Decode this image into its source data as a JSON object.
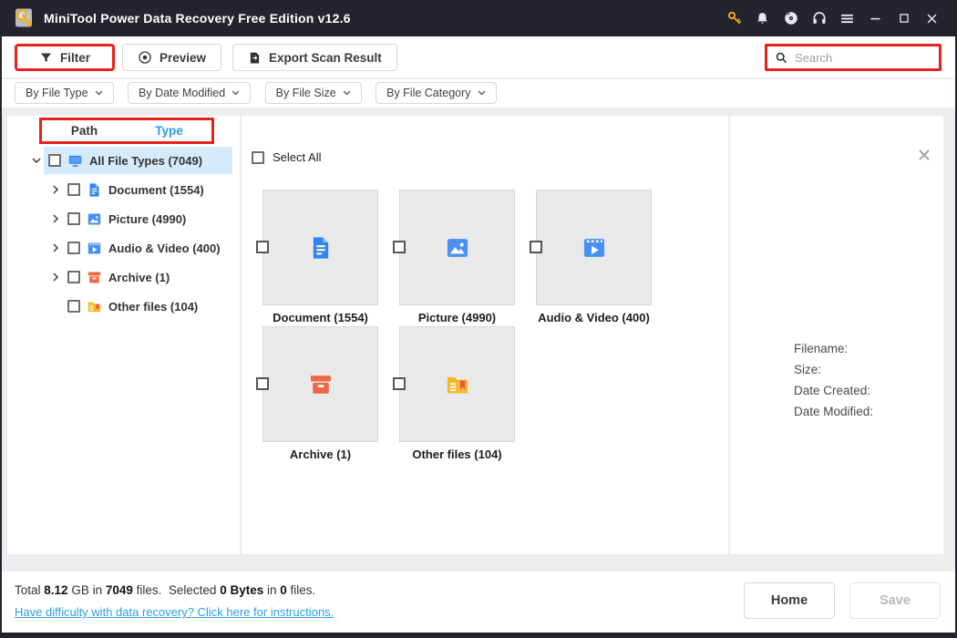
{
  "window": {
    "title": "MiniTool Power Data Recovery Free Edition v12.6"
  },
  "titlebar": {
    "icons": [
      "key",
      "bell",
      "disc",
      "headset",
      "menu",
      "minimize",
      "maximize",
      "close"
    ]
  },
  "toolbar": {
    "filter_label": "Filter",
    "preview_label": "Preview",
    "export_label": "Export Scan Result",
    "search_placeholder": "Search"
  },
  "filters": {
    "items": [
      {
        "label": "By File Type"
      },
      {
        "label": "By Date Modified"
      },
      {
        "label": "By File Size"
      },
      {
        "label": "By File Category"
      }
    ]
  },
  "sidebar": {
    "tabs": {
      "path": "Path",
      "type": "Type"
    },
    "items": [
      {
        "label": "All File Types (7049)",
        "icon": "monitor",
        "selected": true,
        "expanded": true
      },
      {
        "label": "Document (1554)",
        "icon": "document"
      },
      {
        "label": "Picture (4990)",
        "icon": "picture"
      },
      {
        "label": "Audio & Video (400)",
        "icon": "video"
      },
      {
        "label": "Archive (1)",
        "icon": "archive"
      },
      {
        "label": "Other files (104)",
        "icon": "folder"
      }
    ]
  },
  "main": {
    "select_all_label": "Select All",
    "cards": [
      {
        "label": "Document (1554)",
        "icon": "document"
      },
      {
        "label": "Picture (4990)",
        "icon": "picture"
      },
      {
        "label": "Audio & Video (400)",
        "icon": "video"
      },
      {
        "label": "Archive (1)",
        "icon": "archive"
      },
      {
        "label": "Other files (104)",
        "icon": "folder"
      }
    ]
  },
  "details": {
    "filename_label": "Filename:",
    "size_label": "Size:",
    "date_created_label": "Date Created:",
    "date_modified_label": "Date Modified:"
  },
  "footer": {
    "total_label": "Total ",
    "total_size": "8.12",
    "after_size": " GB in ",
    "total_count": "7049",
    "after_count": " files.  ",
    "selected_label": "Selected ",
    "selected_size": "0 Bytes",
    "after_sel_size": " in ",
    "selected_count": "0",
    "after_sel_count": " files.",
    "link_text": "Have difficulty with data recovery? Click here for instructions.",
    "home_label": "Home",
    "save_label": "Save"
  },
  "colors": {
    "titlebar": "#24242e",
    "annotation_red": "#e8221a",
    "accent_blue": "#2e9bea",
    "icon_blue": "#3d86ef",
    "archive_orange": "#ed6a45",
    "folder_yellow": "#f6b823",
    "link_blue": "#2f9ee0",
    "key_gold": "#efa91c",
    "selected_row_bg": "#d5ebfb"
  }
}
